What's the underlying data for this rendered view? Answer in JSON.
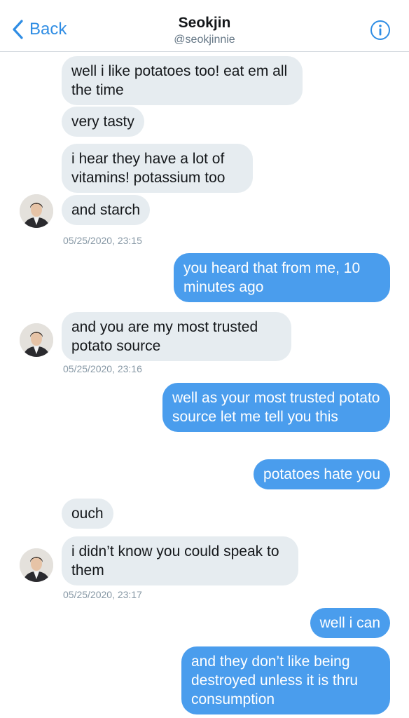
{
  "header": {
    "back_label": "Back",
    "name": "Seokjin",
    "handle": "@seokjinnie"
  },
  "messages": [
    {
      "side": "received",
      "text": "well i like potatoes too! eat em all the time"
    },
    {
      "side": "received",
      "text": "very tasty"
    },
    {
      "side": "received",
      "text": "i hear they have a lot of vitamins! potassium too"
    },
    {
      "side": "received",
      "text": "and starch"
    },
    {
      "side": "sent",
      "text": "you heard that from me, 10 minutes ago"
    },
    {
      "side": "received",
      "text": "and you are my most trusted potato source"
    },
    {
      "side": "sent",
      "text": "well as your most trusted potato source let me tell you this"
    },
    {
      "side": "sent",
      "text": "potatoes hate you"
    },
    {
      "side": "received",
      "text": "ouch"
    },
    {
      "side": "received",
      "text": "i didn’t know you could speak to them"
    },
    {
      "side": "sent",
      "text": "well i can"
    },
    {
      "side": "sent",
      "text": "and they don’t like being destroyed unless it is thru consumption"
    }
  ],
  "timestamps": [
    "05/25/2020, 23:15",
    "05/25/2020, 23:16",
    "05/25/2020, 23:17"
  ],
  "colors": {
    "accent": "#2f8de4",
    "sent_bubble": "#4a9ded",
    "received_bubble": "#e6ecf0"
  }
}
